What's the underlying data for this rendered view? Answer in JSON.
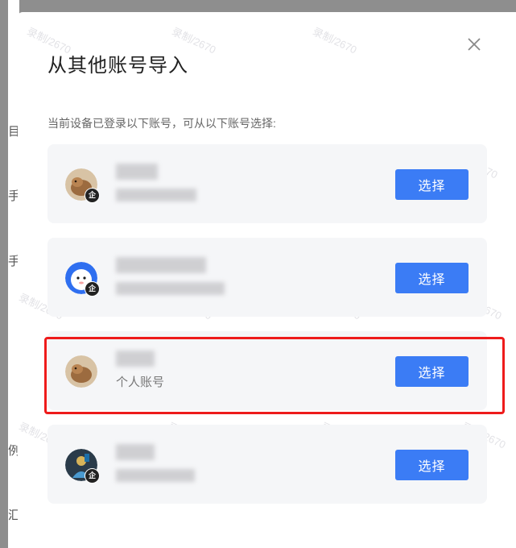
{
  "dialog": {
    "title": "从其他账号导入",
    "subtitle": "当前设备已登录以下账号，可从以下账号选择:",
    "close_glyph": "×"
  },
  "accounts": [
    {
      "type_label": "",
      "badge": "企",
      "select_label": "选择",
      "avatar_icon": "capybara-avatar-icon"
    },
    {
      "type_label": "",
      "badge": "企",
      "select_label": "选择",
      "avatar_icon": "blue-mascot-avatar-icon"
    },
    {
      "type_label": "个人账号",
      "badge": "",
      "select_label": "选择",
      "avatar_icon": "capybara-avatar-icon"
    },
    {
      "type_label": "",
      "badge": "企",
      "select_label": "选择",
      "avatar_icon": "figure-avatar-icon"
    }
  ],
  "backdrop_chars": [
    "目",
    "手",
    "手",
    "例",
    "汇"
  ],
  "watermark": "录制/2670",
  "colors": {
    "accent": "#3b7cf5",
    "highlight": "#ee1b1b",
    "card_bg": "#f5f6f8"
  }
}
